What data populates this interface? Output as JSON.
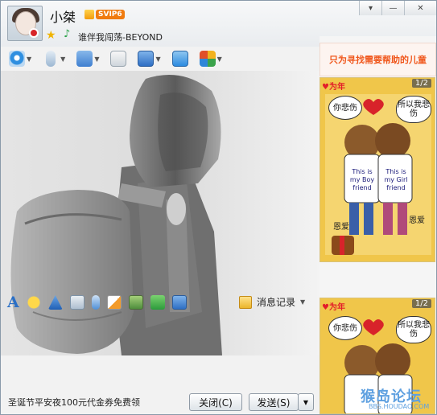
{
  "contact": {
    "name": "小桀",
    "vip_badge": "SVIP6",
    "signature": "谁伴我闯荡-BEYOND"
  },
  "window_controls": {
    "menu_icon": "menu-icon",
    "minimize_icon": "minimize-icon",
    "close_icon": "close-icon"
  },
  "toolbar": {
    "items": [
      {
        "name": "video-call",
        "icon": "camera-icon",
        "color": "#2f8fe0"
      },
      {
        "name": "voice-call",
        "icon": "microphone-icon",
        "color": "#6fa0d0"
      },
      {
        "name": "send-file",
        "icon": "folder-arrow-icon",
        "color": "#4a86d0"
      },
      {
        "name": "sms",
        "icon": "chat-plus-icon",
        "color": "#49a548"
      },
      {
        "name": "remote-assist",
        "icon": "monitor-icon",
        "color": "#3e7fd2"
      },
      {
        "name": "share-screen",
        "icon": "screen-share-icon",
        "color": "#2d8be0"
      },
      {
        "name": "apps",
        "icon": "apps-grid-icon",
        "color": "#e04f2a"
      }
    ]
  },
  "format_bar": {
    "font_label": "A",
    "history_label": "消息记录",
    "items": [
      "emoji-icon",
      "ring-icon",
      "screenshot-icon",
      "voice-message-icon",
      "handwrite-icon",
      "image-icon",
      "gift-icon",
      "screen-capture-icon"
    ]
  },
  "bottom": {
    "promo_text": "圣诞节平安夜100元代金券免费领",
    "close_label": "关闭(C)",
    "send_label": "发送(S)"
  },
  "right_panel": {
    "banner_text": "只为寻找需要帮助的儿童",
    "card1": {
      "counter": "1/2",
      "brand": "♥为年",
      "bubble_left": "你悲伤",
      "bubble_right": "所以我悲伤",
      "shirt_left": "This is my Boy friend",
      "shirt_right": "This is my Girl friend",
      "tag_left": "恩爱",
      "tag_right": "恩爱"
    },
    "card2": {
      "counter": "1/2",
      "brand": "♥为年",
      "bubble_left": "你悲伤",
      "bubble_right": "所以我悲伤"
    },
    "watermark": "猴岛论坛",
    "watermark_url": "BBS.HOUDAO.COM"
  },
  "colors": {
    "accent_orange": "#f0571c",
    "card_gold": "#e8b42a",
    "brand_red": "#e31e29"
  }
}
